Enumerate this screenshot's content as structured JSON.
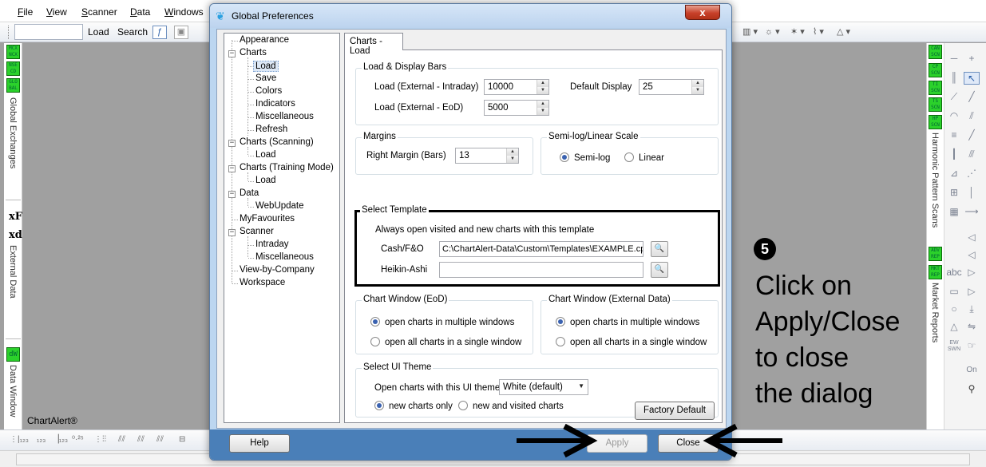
{
  "app": {
    "menu": [
      "File",
      "View",
      "Scanner",
      "Data",
      "Windows"
    ],
    "toolbar": {
      "load": "Load",
      "search": "Search"
    },
    "left_strip": {
      "badges": [
        "MCX NCX",
        "NSE CD",
        "GLO BAL"
      ],
      "global_exchanges": "Global Exchanges",
      "xf": "xF",
      "xd": "xd",
      "external_data": "External Data",
      "dw": "dW",
      "data_window": "Data Window"
    },
    "right_strip": {
      "badges": [
        "CAN SCN",
        "CP SCN",
        "TI SCN",
        "TS SCN",
        "HP SCN"
      ],
      "harmonic_pattern_scans": "Harmonic Pattern Scans",
      "report_badges": [
        "ADV REP",
        "MKT REP"
      ],
      "market_reports": "Market Reports"
    },
    "right_tools": {
      "abc": "abc",
      "on": "On",
      "ew_swn": "EW SWN"
    },
    "mdi_label": "ChartAlert®"
  },
  "dialog": {
    "title": "Global Preferences",
    "close_glyph": "x",
    "tree": [
      {
        "label": "Appearance",
        "level": 0
      },
      {
        "label": "Charts",
        "level": 0,
        "expander": "−"
      },
      {
        "label": "Load",
        "level": 1,
        "selected": true
      },
      {
        "label": "Save",
        "level": 1
      },
      {
        "label": "Colors",
        "level": 1
      },
      {
        "label": "Indicators",
        "level": 1
      },
      {
        "label": "Miscellaneous",
        "level": 1
      },
      {
        "label": "Refresh",
        "level": 1
      },
      {
        "label": "Charts (Scanning)",
        "level": 0,
        "expander": "−"
      },
      {
        "label": "Load",
        "level": 1
      },
      {
        "label": "Charts (Training Mode)",
        "level": 0,
        "expander": "−"
      },
      {
        "label": "Load",
        "level": 1
      },
      {
        "label": "Data",
        "level": 0,
        "expander": "−"
      },
      {
        "label": "WebUpdate",
        "level": 1
      },
      {
        "label": "MyFavourites",
        "level": 0
      },
      {
        "label": "Scanner",
        "level": 0,
        "expander": "−"
      },
      {
        "label": "Intraday",
        "level": 1
      },
      {
        "label": "Miscellaneous",
        "level": 1
      },
      {
        "label": "View-by-Company",
        "level": 0
      },
      {
        "label": "Workspace",
        "level": 0
      }
    ],
    "tab": "Charts - Load",
    "load_display": {
      "title": "Load & Display Bars",
      "intraday_label": "Load (External - Intraday)",
      "intraday_value": "10000",
      "eod_label": "Load (External - EoD)",
      "eod_value": "5000",
      "default_display_label": "Default Display",
      "default_display_value": "25"
    },
    "margins": {
      "title": "Margins",
      "right_margin_label": "Right Margin (Bars)",
      "right_margin_value": "13"
    },
    "scale": {
      "title": "Semi-log/Linear Scale",
      "semilog": "Semi-log",
      "linear": "Linear"
    },
    "template": {
      "title": "Select Template",
      "desc": "Always open visited and new charts with this template",
      "cash_label": "Cash/F&O",
      "cash_value": "C:\\ChartAlert-Data\\Custom\\Templates\\EXAMPLE.cp",
      "heikin_label": "Heikin-Ashi",
      "heikin_value": ""
    },
    "chart_window_eod": {
      "title": "Chart Window (EoD)",
      "multiple": "open charts in multiple windows",
      "single": "open all charts in a single window"
    },
    "chart_window_ext": {
      "title": "Chart Window (External Data)",
      "multiple": "open charts in multiple windows",
      "single": "open all charts in a single window"
    },
    "ui_theme": {
      "title": "Select UI Theme",
      "label": "Open charts with this UI theme",
      "value": "White (default)",
      "new_only": "new charts only",
      "new_visited": "new and visited charts"
    },
    "factory_default": "Factory Default",
    "help": "Help",
    "apply": "Apply",
    "close": "Close"
  },
  "annotation": {
    "step": "5",
    "lines": [
      "Click on",
      "Apply/Close",
      "to close",
      "the dialog"
    ]
  }
}
